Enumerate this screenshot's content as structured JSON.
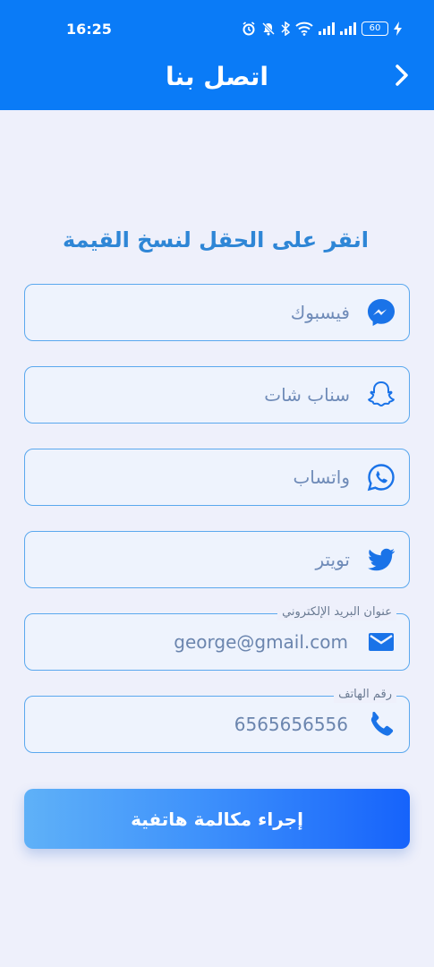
{
  "status_bar": {
    "time": "16:25",
    "battery": "60",
    "icons": [
      "alarm-icon",
      "mute-icon",
      "bluetooth-icon",
      "wifi-icon",
      "signal-icon",
      "signal-icon",
      "battery-icon",
      "charging-icon"
    ]
  },
  "header": {
    "title": "اتصل بنا",
    "back_icon": "chevron-right-icon",
    "background": "#0a7bf7"
  },
  "instruction": "انقر على الحقل لنسخ القيمة",
  "fields": [
    {
      "name": "facebook",
      "label": "فيسبوك",
      "icon": "messenger-icon"
    },
    {
      "name": "snapchat",
      "label": "سناب شات",
      "icon": "snapchat-icon"
    },
    {
      "name": "whatsapp",
      "label": "واتساب",
      "icon": "whatsapp-icon"
    },
    {
      "name": "twitter",
      "label": "تويتر",
      "icon": "twitter-icon"
    },
    {
      "name": "email",
      "legend": "عنوان البريد الإلكتروني",
      "value": "george@gmail.com",
      "icon": "mail-icon"
    },
    {
      "name": "phone",
      "legend": "رقم الهاتف",
      "value": "6565656556",
      "icon": "phone-icon"
    }
  ],
  "call_button": {
    "label": "إجراء مكالمة هاتفية"
  },
  "colors": {
    "accent": "#1a73e8",
    "border": "#5aa8ee",
    "background": "#eef0fb"
  }
}
